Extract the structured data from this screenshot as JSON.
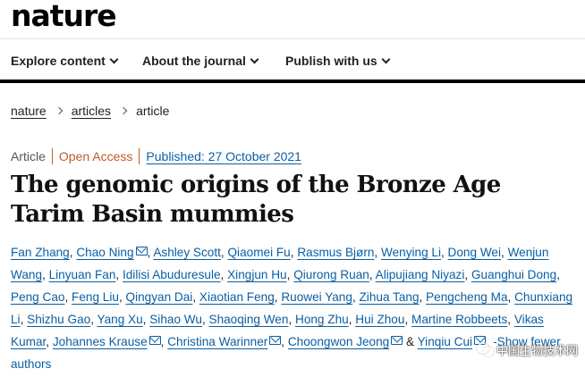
{
  "brand": {
    "logo_text": "nature"
  },
  "nav": {
    "items": [
      {
        "label": "Explore content"
      },
      {
        "label": "About the journal"
      },
      {
        "label": "Publish with us"
      }
    ]
  },
  "breadcrumb": {
    "items": [
      {
        "label": "nature"
      },
      {
        "label": "articles"
      }
    ],
    "current": "article"
  },
  "meta": {
    "type": "Article",
    "access": "Open Access",
    "published": "Published: 27 October 2021"
  },
  "article": {
    "title": "The genomic origins of the Bronze Age Tarim Basin mummies"
  },
  "authors": {
    "list": [
      {
        "name": "Fan Zhang"
      },
      {
        "name": "Chao Ning",
        "mail": true
      },
      {
        "name": "Ashley Scott"
      },
      {
        "name": "Qiaomei Fu"
      },
      {
        "name": "Rasmus Bjørn"
      },
      {
        "name": "Wenying Li"
      },
      {
        "name": "Dong Wei"
      },
      {
        "name": "Wenjun Wang"
      },
      {
        "name": "Linyuan Fan"
      },
      {
        "name": "Idilisi Abuduresule"
      },
      {
        "name": "Xingjun Hu"
      },
      {
        "name": "Qiurong Ruan"
      },
      {
        "name": "Alipujiang Niyazi"
      },
      {
        "name": "Guanghui Dong"
      },
      {
        "name": "Peng Cao"
      },
      {
        "name": "Feng Liu"
      },
      {
        "name": "Qingyan Dai"
      },
      {
        "name": "Xiaotian Feng"
      },
      {
        "name": "Ruowei Yang"
      },
      {
        "name": "Zihua Tang"
      },
      {
        "name": "Pengcheng Ma"
      },
      {
        "name": "Chunxiang Li"
      },
      {
        "name": "Shizhu Gao"
      },
      {
        "name": "Yang Xu"
      },
      {
        "name": "Sihao Wu"
      },
      {
        "name": "Shaoqing Wen"
      },
      {
        "name": "Hong Zhu"
      },
      {
        "name": "Hui Zhou"
      },
      {
        "name": "Martine Robbeets"
      },
      {
        "name": "Vikas Kumar"
      },
      {
        "name": "Johannes Krause",
        "mail": true
      },
      {
        "name": "Christina Warinner",
        "mail": true
      },
      {
        "name": "Choongwon Jeong",
        "mail": true
      },
      {
        "name": "Yinqiu Cui",
        "mail": true,
        "last": true
      }
    ],
    "and_symbol": "&",
    "toggle_label": "-Show fewer authors"
  },
  "watermark": {
    "text": "中国生物技术网"
  },
  "colors": {
    "link": "#0a5fa3",
    "open_access": "#c05b2c",
    "text": "#222222"
  }
}
